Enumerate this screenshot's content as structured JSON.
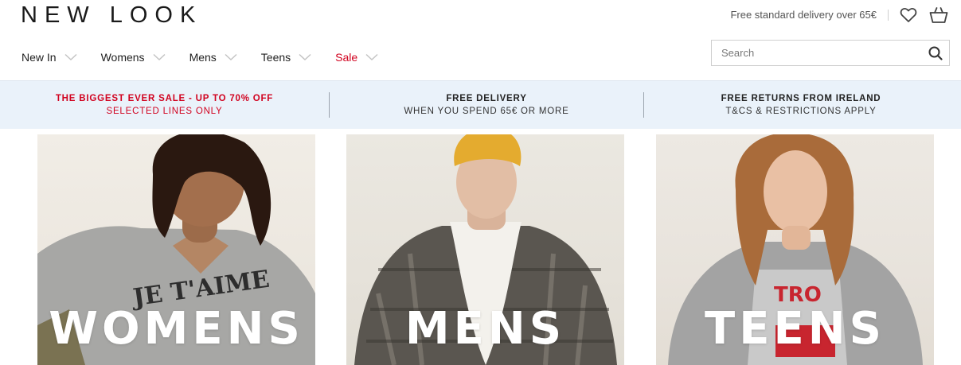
{
  "header": {
    "logo": "NEW LOOK",
    "delivery_note": "Free standard delivery over 65€",
    "wishlist_icon": "heart-icon",
    "basket_icon": "basket-icon"
  },
  "nav": {
    "items": [
      {
        "label": "New In"
      },
      {
        "label": "Womens"
      },
      {
        "label": "Mens"
      },
      {
        "label": "Teens"
      },
      {
        "label": "Sale"
      }
    ]
  },
  "search": {
    "placeholder": "Search",
    "icon": "search-icon"
  },
  "promo": [
    {
      "title": "THE BIGGEST EVER SALE - UP TO 70% OFF",
      "sub": "SELECTED LINES ONLY"
    },
    {
      "title": "FREE DELIVERY",
      "sub": "WHEN YOU SPEND 65€ OR MORE"
    },
    {
      "title": "FREE RETURNS FROM IRELAND",
      "sub": "T&CS & RESTRICTIONS APPLY"
    }
  ],
  "tiles": [
    {
      "label": "WOMENS"
    },
    {
      "label": "MENS"
    },
    {
      "label": "TEENS"
    }
  ],
  "colors": {
    "sale_red": "#d1021f",
    "promo_bg": "#eaf2fa",
    "text": "#222222"
  }
}
